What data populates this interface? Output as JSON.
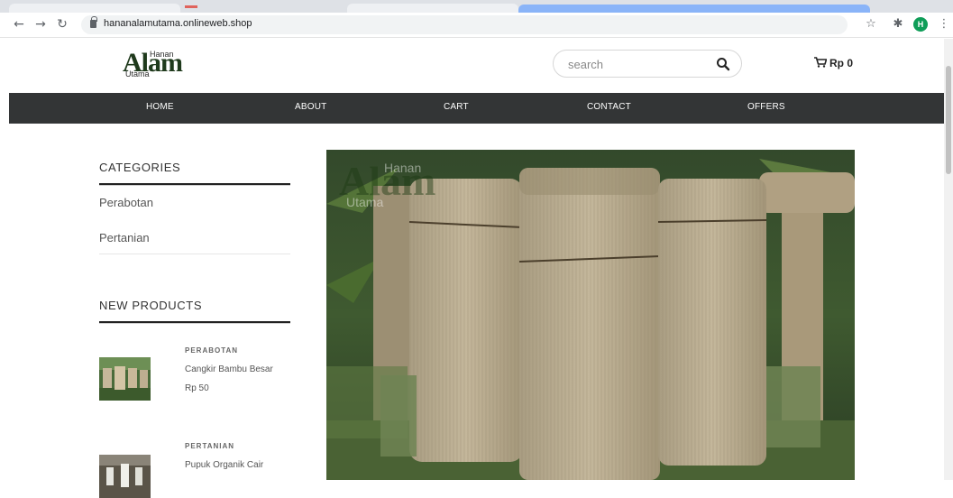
{
  "browser": {
    "url": "hananalamutama.onlineweb.shop",
    "avatar_letter": "H",
    "back_icon": "arrow-left-icon",
    "forward_icon": "arrow-right-icon",
    "reload_icon": "reload-icon"
  },
  "header": {
    "logo_main": "Alam",
    "logo_top": "Hanan",
    "logo_bottom": "Utama",
    "search_placeholder": "search",
    "cart_total": "Rp 0"
  },
  "nav": {
    "items": [
      "HOME",
      "ABOUT",
      "CART",
      "CONTACT",
      "OFFERS"
    ]
  },
  "sidebar": {
    "categories_title": "CATEGORIES",
    "categories": [
      "Perabotan",
      "Pertanian"
    ],
    "new_products_title": "NEW PRODUCTS",
    "products": [
      {
        "category": "PERABOTAN",
        "name": "Cangkir Bambu Besar",
        "price": "Rp 50"
      },
      {
        "category": "PERTANIAN",
        "name": "Pupuk Organik Cair",
        "price": ""
      }
    ]
  },
  "hero": {
    "watermark_main": "Alam",
    "watermark_top": "Hanan",
    "watermark_bottom": "Utama"
  },
  "colors": {
    "nav_bg": "#333536",
    "accent_green": "#0f9d58"
  }
}
